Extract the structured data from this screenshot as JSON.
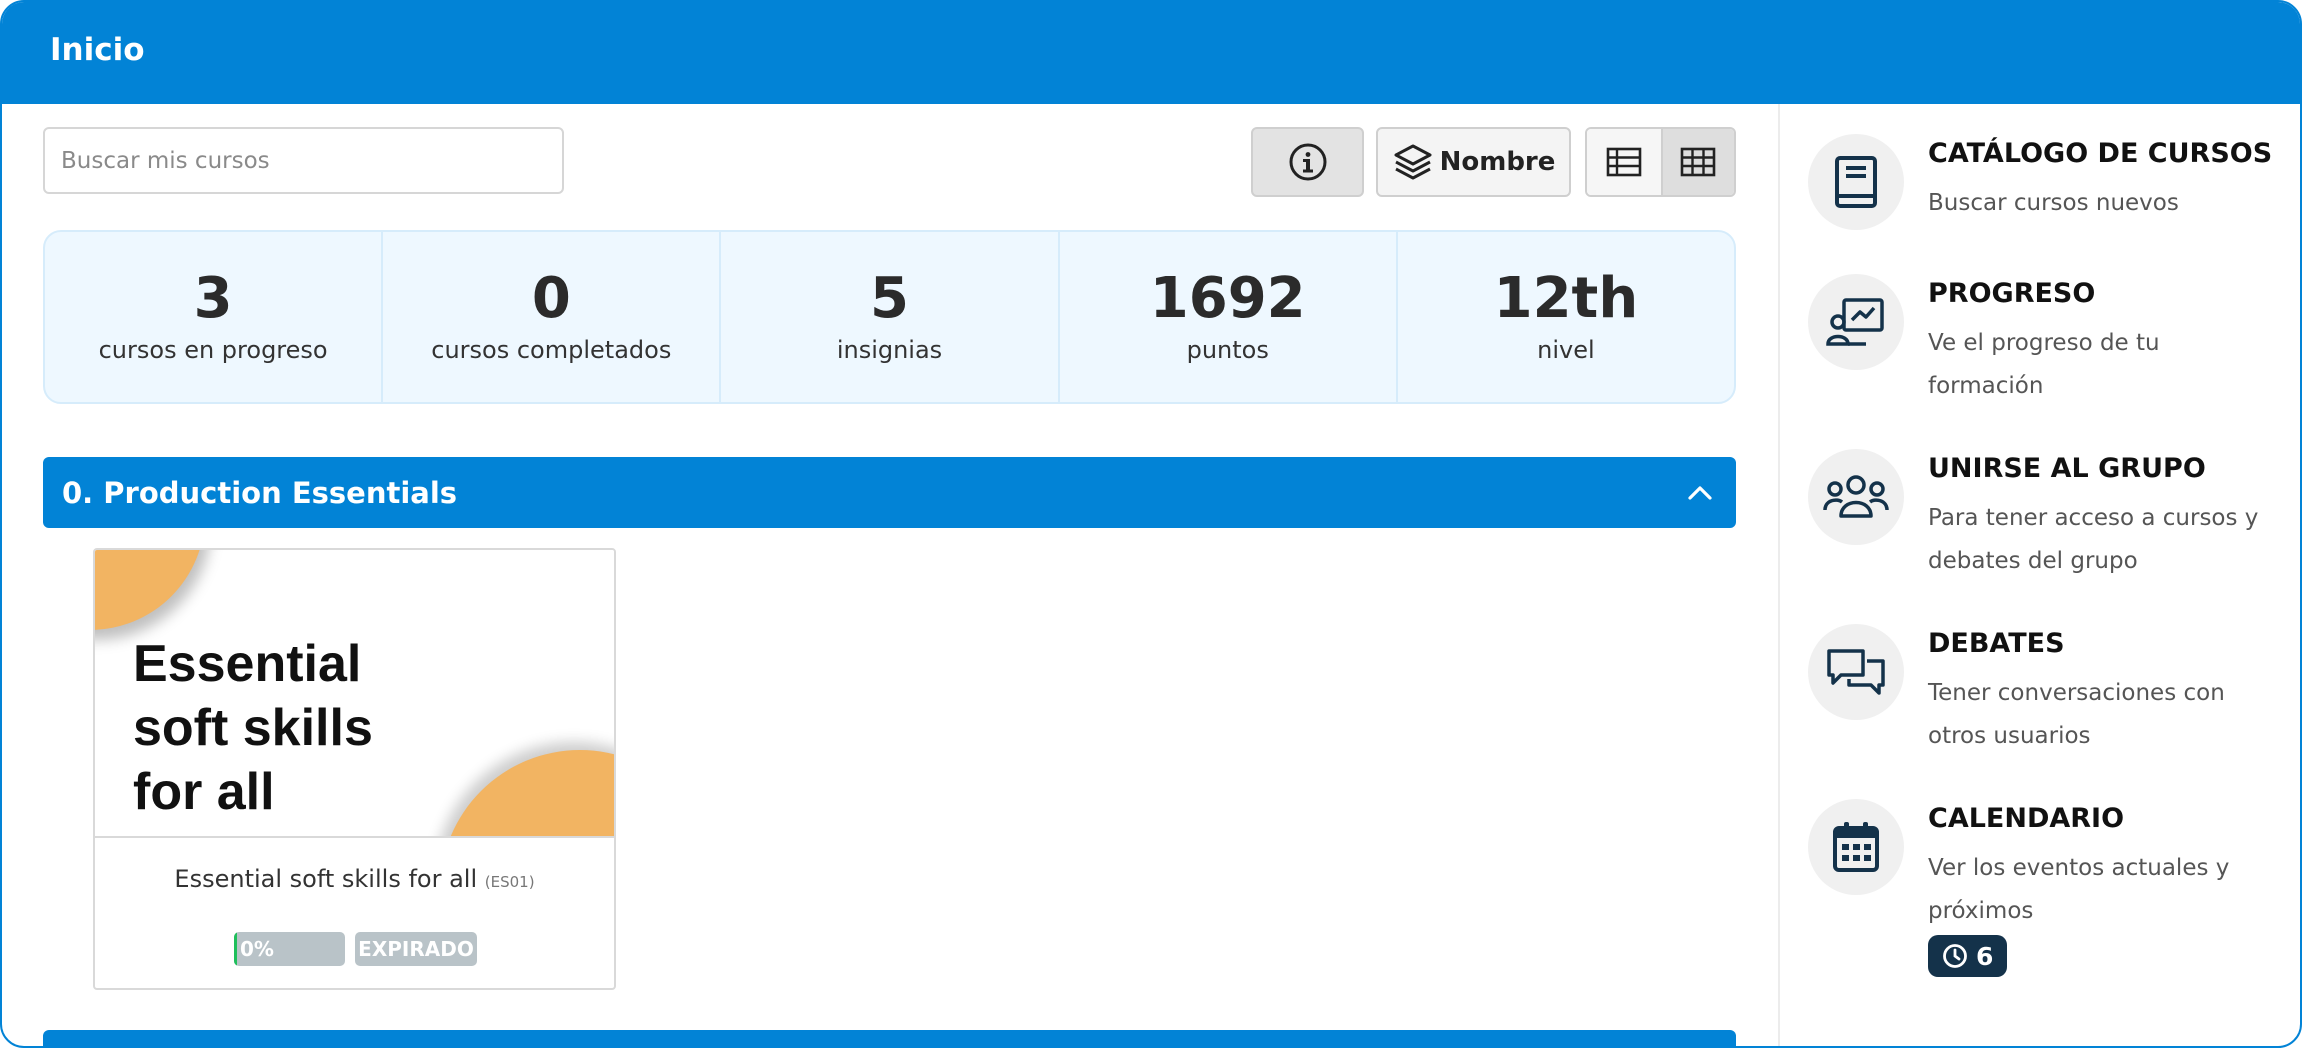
{
  "header": {
    "title": "Inicio"
  },
  "search": {
    "placeholder": "Buscar mis cursos"
  },
  "toolbar": {
    "info_icon": "info-circle-icon",
    "sort_label": "Nombre",
    "sort_icon": "layers-icon",
    "view_list_icon": "list-view-icon",
    "view_grid_icon": "grid-view-icon",
    "active_view": "grid"
  },
  "stats": [
    {
      "value": "3",
      "label": "cursos en progreso"
    },
    {
      "value": "0",
      "label": "cursos completados"
    },
    {
      "value": "5",
      "label": "insignias"
    },
    {
      "value": "1692",
      "label": "puntos"
    },
    {
      "value": "12th",
      "label": "nivel"
    }
  ],
  "category": {
    "title": "0. Production Essentials",
    "expanded": true
  },
  "course": {
    "thumbnail_text": "Essential soft skills for all",
    "name": "Essential soft skills for all",
    "code": "(ES01)",
    "progress_label": "0%",
    "progress_value": 0.03,
    "status": "EXPIRADO"
  },
  "sidebar": {
    "items": [
      {
        "title": "CATÁLOGO DE CURSOS",
        "desc": "Buscar cursos nuevos",
        "icon": "book-icon"
      },
      {
        "title": "PROGRESO",
        "desc": "Ve el progreso de tu formación",
        "icon": "progress-chart-icon"
      },
      {
        "title": "UNIRSE AL GRUPO",
        "desc": "Para tener acceso a cursos y debates del grupo",
        "icon": "group-icon"
      },
      {
        "title": "DEBATES",
        "desc": "Tener conversaciones con otros usuarios",
        "icon": "chat-bubbles-icon"
      },
      {
        "title": "CALENDARIO",
        "desc": "Ver los eventos actuales y próximos",
        "icon": "calendar-icon"
      }
    ],
    "calendar_events": "6"
  },
  "colors": {
    "primary": "#0283d6",
    "stats_bg": "#eef8ff",
    "accent_orange": "#f2b462",
    "progress_green": "#1fbf5b",
    "dark_badge": "#14324a"
  }
}
